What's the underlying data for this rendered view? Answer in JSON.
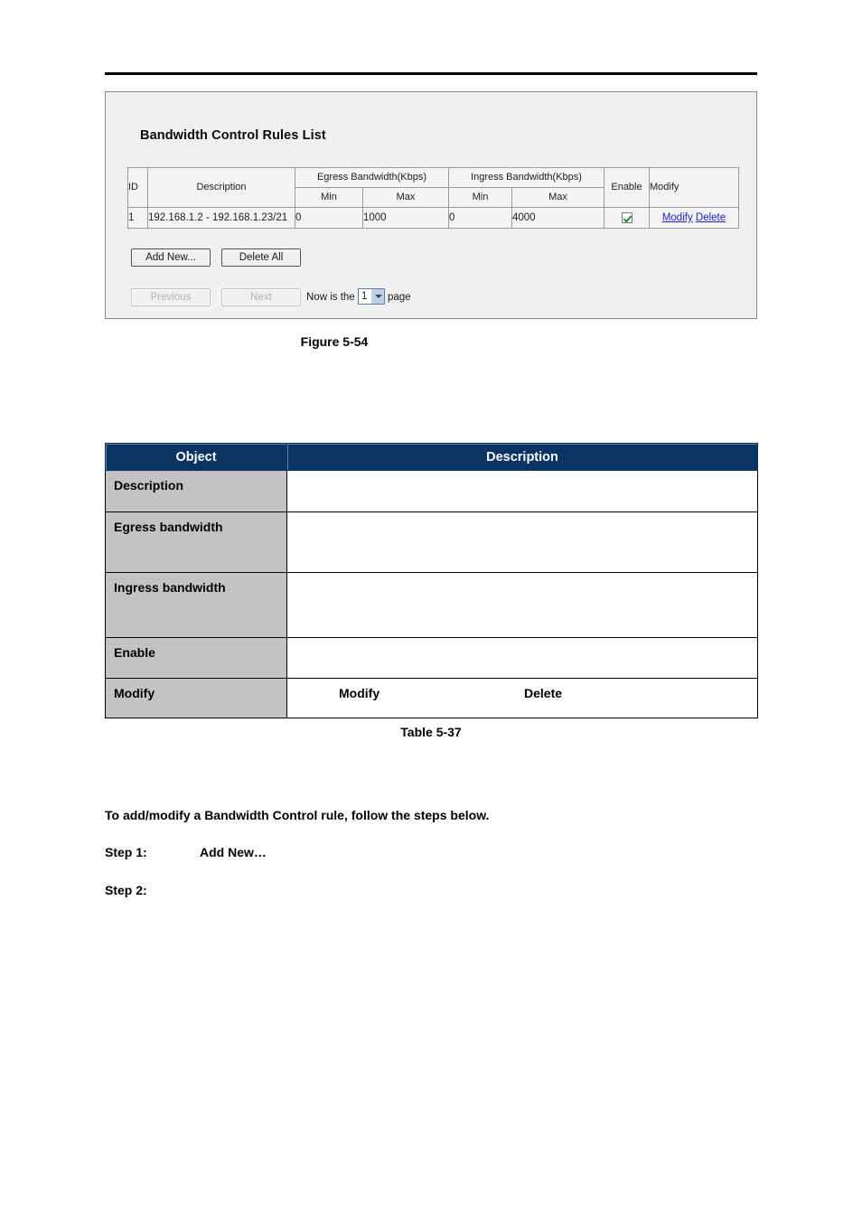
{
  "document": {
    "figure_caption": "Figure 5-54",
    "table_caption": "Table 5-37",
    "intro_paragraph": "To add/modify a Bandwidth Control rule, follow the steps below.",
    "steps": [
      {
        "label": "Step 1:",
        "text": "Add New…"
      },
      {
        "label": "Step 2:",
        "text": ""
      }
    ]
  },
  "screenshot_panel": {
    "title": "Bandwidth Control Rules List",
    "rules_table": {
      "headers": {
        "id": "ID",
        "description": "Description",
        "egress_group": "Egress Bandwidth(Kbps)",
        "ingress_group": "Ingress Bandwidth(Kbps)",
        "egress_min": "Min",
        "egress_max": "Max",
        "ingress_min": "Min",
        "ingress_max": "Max",
        "enable": "Enable",
        "modify": "Modify"
      },
      "rows": [
        {
          "id": "1",
          "description": "192.168.1.2 - 192.168.1.23/21",
          "egress_min": "0",
          "egress_max": "1000",
          "ingress_min": "0",
          "ingress_max": "4000",
          "enabled": true,
          "modify_link": "Modify",
          "delete_link": "Delete"
        }
      ]
    },
    "buttons": {
      "add_new": "Add New...",
      "delete_all": "Delete All",
      "previous": "Previous",
      "next": "Next"
    },
    "pager": {
      "prefix": "Now is the",
      "page_value": "1",
      "suffix": "page"
    }
  },
  "description_table": {
    "headers": {
      "object": "Object",
      "description": "Description"
    },
    "rows": [
      {
        "object": "Description",
        "description": ""
      },
      {
        "object": "Egress bandwidth",
        "description": ""
      },
      {
        "object": "Ingress bandwidth",
        "description": ""
      },
      {
        "object": "Enable",
        "description": ""
      },
      {
        "object": "Modify",
        "description": "",
        "modify_word": "Modify",
        "delete_word": "Delete"
      }
    ]
  },
  "colors": {
    "header_navy": "#0a3464",
    "object_gray": "#c3c3c3",
    "panel_gray": "#f0f0f0",
    "link_blue": "#2020cc",
    "check_green": "#1f8a2f"
  }
}
